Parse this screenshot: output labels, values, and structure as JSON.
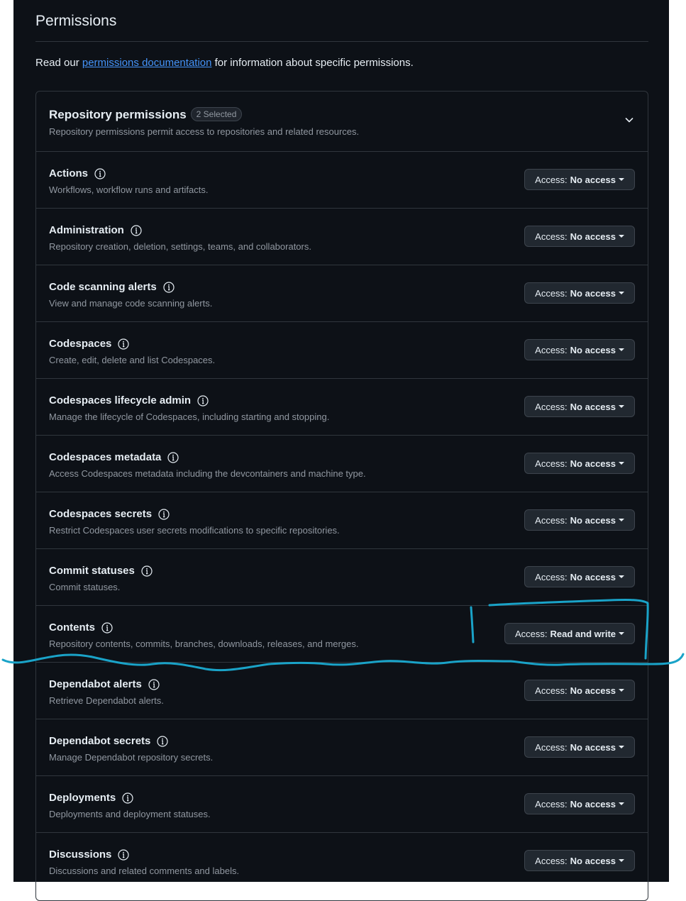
{
  "section": {
    "title": "Permissions",
    "intro_before": "Read our ",
    "intro_link": "permissions documentation",
    "intro_after": " for information about specific permissions."
  },
  "repo": {
    "title": "Repository permissions",
    "counter": "2 Selected",
    "description": "Repository permissions permit access to repositories and related resources."
  },
  "access_prefix": "Access:",
  "permissions": [
    {
      "name": "Actions",
      "description": "Workflows, workflow runs and artifacts.",
      "access": "No access"
    },
    {
      "name": "Administration",
      "description": "Repository creation, deletion, settings, teams, and collaborators.",
      "access": "No access"
    },
    {
      "name": "Code scanning alerts",
      "description": "View and manage code scanning alerts.",
      "access": "No access"
    },
    {
      "name": "Codespaces",
      "description": "Create, edit, delete and list Codespaces.",
      "access": "No access"
    },
    {
      "name": "Codespaces lifecycle admin",
      "description": "Manage the lifecycle of Codespaces, including starting and stopping.",
      "access": "No access"
    },
    {
      "name": "Codespaces metadata",
      "description": "Access Codespaces metadata including the devcontainers and machine type.",
      "access": "No access"
    },
    {
      "name": "Codespaces secrets",
      "description": "Restrict Codespaces user secrets modifications to specific repositories.",
      "access": "No access"
    },
    {
      "name": "Commit statuses",
      "description": "Commit statuses.",
      "access": "No access"
    },
    {
      "name": "Contents",
      "description": "Repository contents, commits, branches, downloads, releases, and merges.",
      "access": "Read and write"
    },
    {
      "name": "Dependabot alerts",
      "description": "Retrieve Dependabot alerts.",
      "access": "No access"
    },
    {
      "name": "Dependabot secrets",
      "description": "Manage Dependabot repository secrets.",
      "access": "No access"
    },
    {
      "name": "Deployments",
      "description": "Deployments and deployment statuses.",
      "access": "No access"
    },
    {
      "name": "Discussions",
      "description": "Discussions and related comments and labels.",
      "access": "No access"
    }
  ],
  "colors": {
    "background": "#0d1117",
    "link": "#4493f8",
    "annotation": "#1aa3c8"
  },
  "icons": {
    "info": "info-icon",
    "chevron": "chevron-down-icon"
  }
}
